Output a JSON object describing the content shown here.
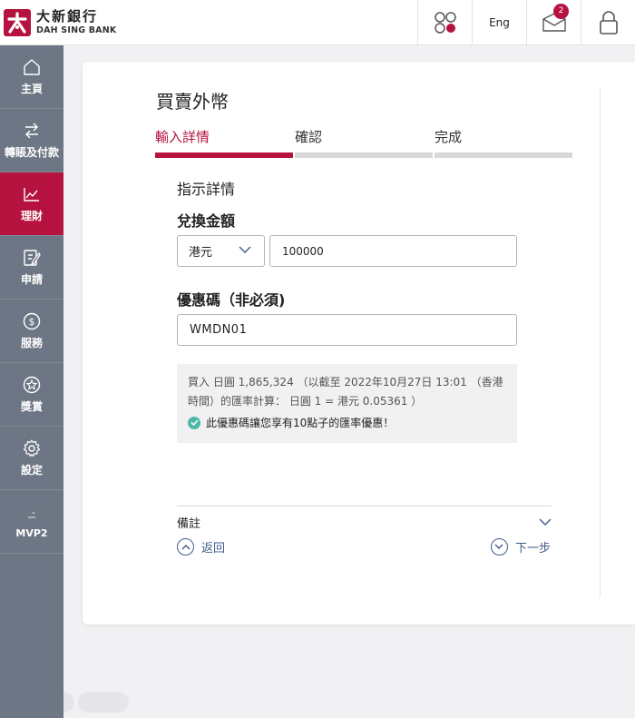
{
  "header": {
    "bank_name_cn": "大新銀行",
    "bank_name_en": "DAH SING BANK",
    "lang_label": "Eng",
    "mail_count": "2"
  },
  "sidebar": {
    "items": [
      {
        "label": "主頁",
        "icon": "home-icon"
      },
      {
        "label": "轉賬及付款",
        "icon": "transfer-icon"
      },
      {
        "label": "理財",
        "icon": "chart-icon"
      },
      {
        "label": "申請",
        "icon": "edit-icon"
      },
      {
        "label": "服務",
        "icon": "dollar-icon"
      },
      {
        "label": "獎賞",
        "icon": "star-icon"
      },
      {
        "label": "設定",
        "icon": "gear-icon"
      },
      {
        "label": "MVP2",
        "icon": "mvp-icon"
      }
    ],
    "active_index": 2
  },
  "page": {
    "title": "買賣外幣",
    "steps": [
      "輸入詳情",
      "確認",
      "完成"
    ],
    "active_step": 0,
    "section_title": "指示詳情",
    "amount_label": "兌換金額",
    "currency": "港元",
    "amount_value": "100000",
    "promo_label": "優惠碼（非必須)",
    "promo_value": "WMDN01",
    "info_line": "買入 日圓 1,865,324 （以截至 2022年10月27日 13:01 （香港時間）的匯率計算： 日圓 1 = 港元 0.05361 ）",
    "promo_message": "此優惠碼讓您享有10點子的匯率優惠！",
    "remarks_label": "備註",
    "back_label": "返回",
    "next_label": "下一步"
  },
  "colors": {
    "brand": "#b5123f",
    "sidebar": "#6d7684",
    "link": "#3e5a8c",
    "success": "#4fb8a6"
  }
}
